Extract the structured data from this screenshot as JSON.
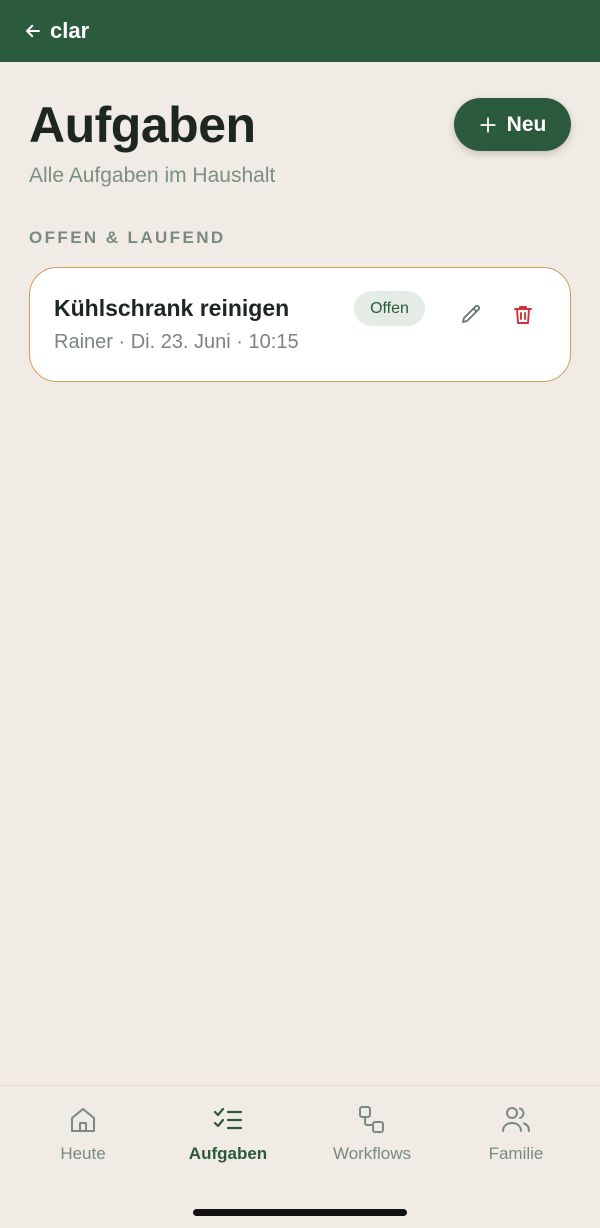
{
  "topbar": {
    "back_label": "clar"
  },
  "header": {
    "title": "Aufgaben",
    "subtitle": "Alle Aufgaben im Haushalt",
    "new_button_label": "Neu"
  },
  "section": {
    "label": "OFFEN & LAUFEND"
  },
  "tasks": [
    {
      "title": "Kühlschrank reinigen",
      "meta": "Rainer · Di. 23. Juni · 10:15",
      "status": "Offen"
    }
  ],
  "nav": {
    "items": [
      {
        "label": "Heute",
        "icon": "home-icon",
        "active": false
      },
      {
        "label": "Aufgaben",
        "icon": "checklist-icon",
        "active": true
      },
      {
        "label": "Workflows",
        "icon": "workflow-icon",
        "active": false
      },
      {
        "label": "Familie",
        "icon": "family-icon",
        "active": false
      }
    ]
  },
  "colors": {
    "primary": "#2c5a3c",
    "background": "#f0ebe4",
    "card_border": "#d29a5c",
    "danger": "#d0323a"
  }
}
